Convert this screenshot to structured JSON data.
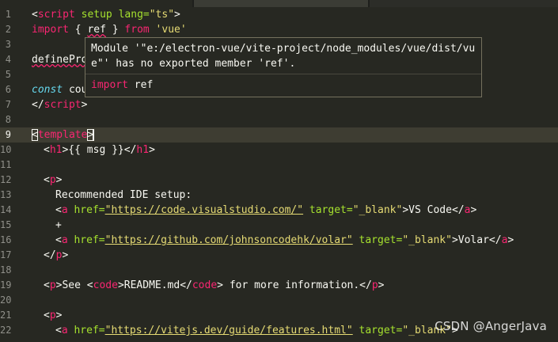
{
  "colors": {
    "background": "#272822",
    "keyword_tag": "#f92672",
    "string": "#e6db74",
    "attribute": "#a6e22e",
    "storage": "#66d9ef",
    "line_number": "#90908a"
  },
  "line_numbers": [
    "1",
    "2",
    "3",
    "4",
    "5",
    "6",
    "7",
    "8",
    "9",
    "10",
    "11",
    "12",
    "13",
    "14",
    "15",
    "16",
    "17",
    "18",
    "19",
    "20",
    "21",
    "22"
  ],
  "current_line": "9",
  "code": {
    "l1_open": "<",
    "l1_tag": "script",
    "l1_attrs": " setup lang=",
    "l1_val": "\"ts\"",
    "l1_close": ">",
    "l2_import": "import",
    "l2_brace_open": " { ",
    "l2_ref": "ref",
    "l2_brace_close": " } ",
    "l2_from": "from",
    "l2_vue": " 'vue'",
    "l4_define": "defineProps",
    "l6_const": "const",
    "l6_rest": " cou",
    "l7_open": "</",
    "l7_tag": "script",
    "l7_close": ">",
    "l9_open": "<",
    "l9_tag": "template",
    "l9_close": ">",
    "l10_open": "<",
    "l10_tag": "h1",
    "l10_mid": ">{{ msg }}</",
    "l10_tag2": "h1",
    "l10_close": ">",
    "l12_open": "<",
    "l12_tag": "p",
    "l12_close": ">",
    "l13_text": "Recommended IDE setup:",
    "l14_open": "<",
    "l14_tag": "a",
    "l14_href": " href=",
    "l14_url": "\"https://code.visualstudio.com/\"",
    "l14_target": " target=",
    "l14_tval": "\"_blank\"",
    "l14_text": ">VS Code</",
    "l14_tag2": "a",
    "l14_close": ">",
    "l15_text": "+",
    "l16_open": "<",
    "l16_tag": "a",
    "l16_href": " href=",
    "l16_url": "\"https://github.com/johnsoncodehk/volar\"",
    "l16_target": " target=",
    "l16_tval": "\"_blank\"",
    "l16_text": ">Volar</",
    "l16_tag2": "a",
    "l16_close": ">",
    "l17_open": "</",
    "l17_tag": "p",
    "l17_close": ">",
    "l19_open": "<",
    "l19_tag": "p",
    "l19_t1": ">See <",
    "l19_code": "code",
    "l19_t2": ">README.md</",
    "l19_code2": "code",
    "l19_t3": "> for more information.</",
    "l19_p2": "p",
    "l19_close": ">",
    "l21_open": "<",
    "l21_tag": "p",
    "l21_close": ">",
    "l22_open": "<",
    "l22_tag": "a",
    "l22_href": " href=",
    "l22_url": "\"https://vitejs.dev/guide/features.html\"",
    "l22_target": " target=",
    "l22_tval": "\"_blank\"",
    "l22_close": ">"
  },
  "tooltip": {
    "message": "Module '\"e:/electron-vue/vite-project/node_modules/vue/dist/vu\ne\"' has no exported member 'ref'.",
    "fix_keyword": "import",
    "fix_rest": " ref"
  },
  "watermark": "CSDN @AngerJava"
}
